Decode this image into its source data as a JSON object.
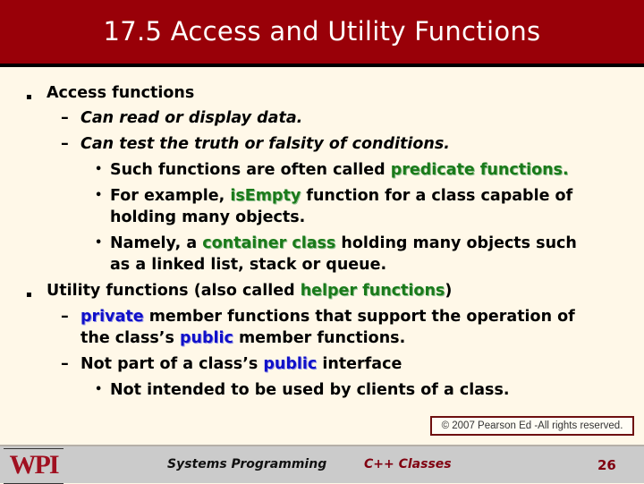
{
  "header": {
    "title": "17.5 Access and Utility Functions",
    "background_color": "#990008"
  },
  "bullets": {
    "access": {
      "label": "Access functions",
      "sub1": "Can read or display data.",
      "sub2": "Can test the truth or falsity of conditions.",
      "sub2a_pre": "Such functions are often called ",
      "sub2a_hl": "predicate functions.",
      "sub2b_pre": "For example, ",
      "sub2b_hl": "isEmpty",
      "sub2b_post": " function for a class capable of",
      "sub2b_cont": "holding many objects.",
      "sub2c_pre": "Namely, a ",
      "sub2c_hl": "container class",
      "sub2c_post": " holding many objects such",
      "sub2c_cont": "as a linked list, stack or queue."
    },
    "utility": {
      "label_pre": "Utility functions (also called ",
      "label_hl": "helper functions",
      "label_post": ")",
      "sub1_hl": "private",
      "sub1_post": " member functions that support the operation of",
      "sub1_cont_pre": "the class’s ",
      "sub1_cont_hl": "public",
      "sub1_cont_post": " member functions.",
      "sub2_pre": "Not part of a class’s ",
      "sub2_hl": "public",
      "sub2_post": " interface",
      "sub2a": "Not intended to be used by clients of a class."
    },
    "marker_l1": "▪",
    "marker_l2": "–",
    "marker_l3": "•",
    "highlight_green": "#1a7a1a",
    "highlight_blue": "#1010c8"
  },
  "copyright": "© 2007 Pearson Ed -All rights reserved.",
  "footer": {
    "logo": "WPI",
    "course": "Systems Programming",
    "topic": "C++ Classes",
    "page_number": "26"
  }
}
